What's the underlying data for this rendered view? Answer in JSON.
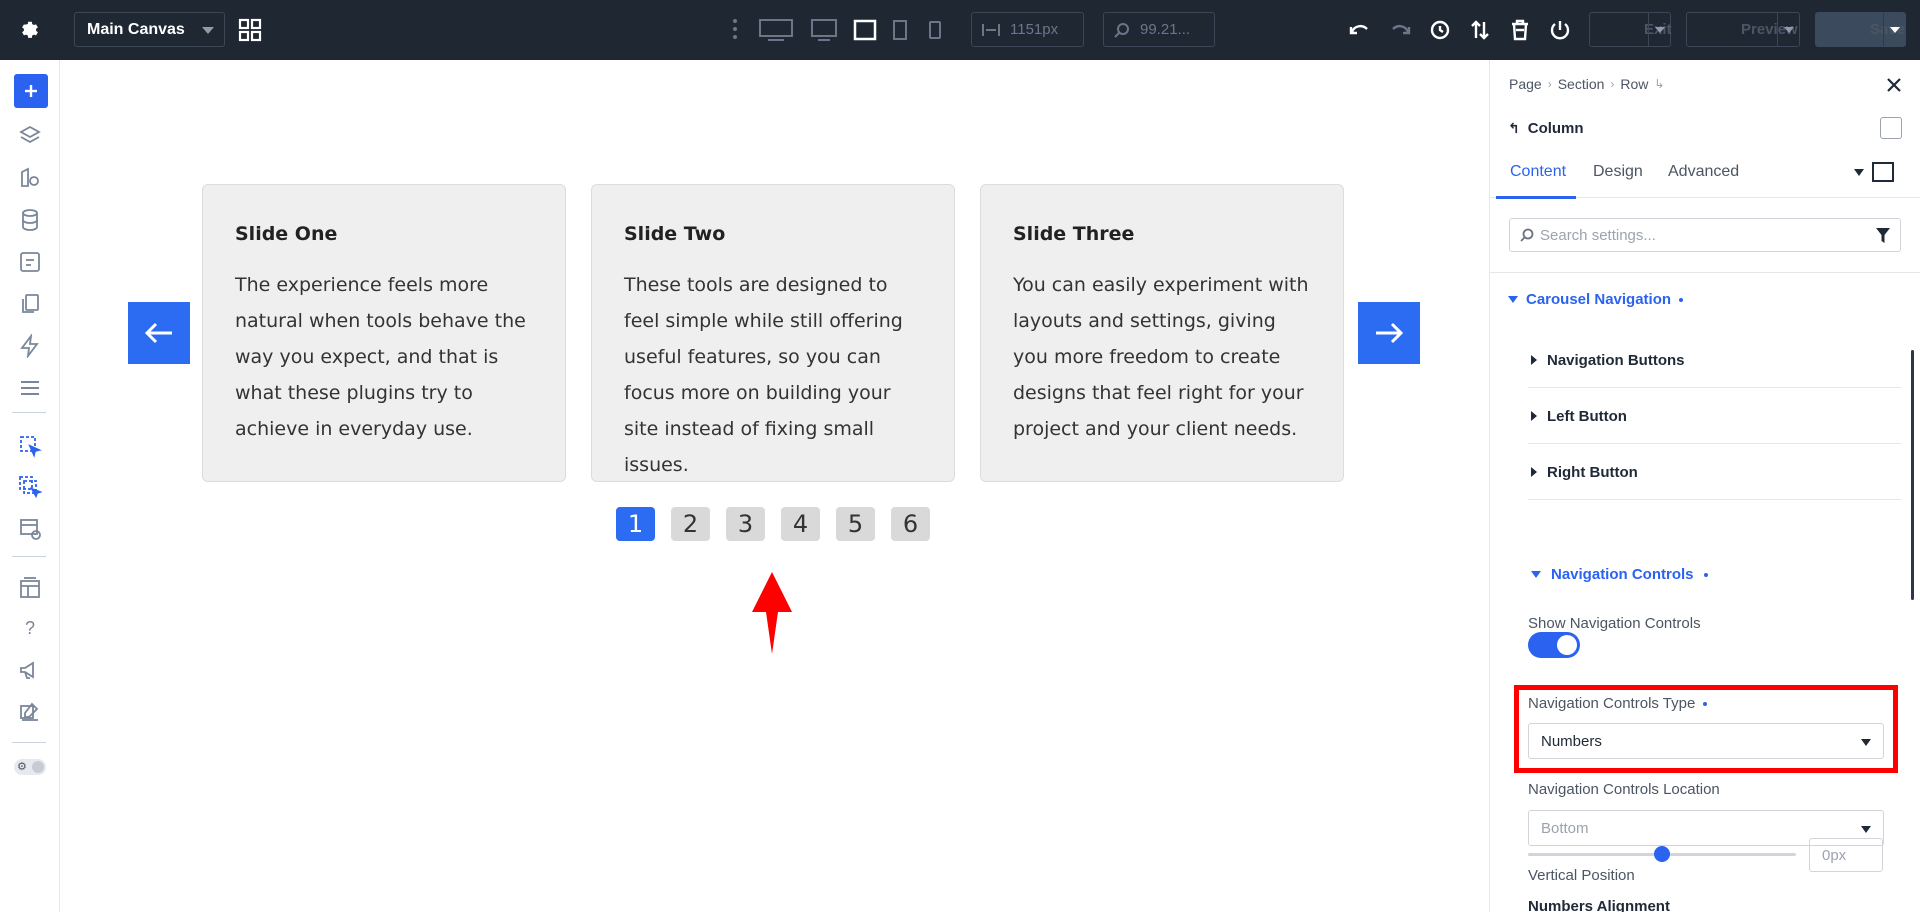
{
  "topbar": {
    "canvas_label": "Main Canvas",
    "width_value": "1151px",
    "zoom_value": "99.21...",
    "exit_label": "Exit",
    "preview_label": "Preview",
    "save_label": "Save"
  },
  "slides": [
    {
      "title": "Slide One",
      "body": "The experience feels more natural when tools behave the way you expect, and that is what these plugins try to achieve in everyday use."
    },
    {
      "title": "Slide Two",
      "body": "These tools are designed to feel simple while still offering useful features, so you can focus more on building your site instead of fixing small issues."
    },
    {
      "title": "Slide Three",
      "body": "You can easily experiment with layouts and settings, giving you more freedom to create designs that feel right for your project and your client needs."
    }
  ],
  "pager": {
    "pages": [
      "1",
      "2",
      "3",
      "4",
      "5",
      "6"
    ],
    "active": 0
  },
  "panel": {
    "breadcrumbs": [
      "Page",
      "Section",
      "Row"
    ],
    "title": "Column",
    "tabs": [
      "Content",
      "Design",
      "Advanced"
    ],
    "search_placeholder": "Search settings...",
    "group_label": "Carousel Navigation",
    "subgroups": [
      "Navigation Buttons",
      "Left Button",
      "Right Button"
    ],
    "open_subgroup": "Navigation Controls",
    "show_controls_label": "Show Navigation Controls",
    "show_controls_on": true,
    "controls_type_label": "Navigation Controls Type",
    "controls_type_value": "Numbers",
    "controls_location_label": "Navigation Controls Location",
    "controls_location_value": "Bottom",
    "vertical_position_label": "Vertical Position",
    "vertical_position_value": "0px",
    "numbers_alignment_label": "Numbers Alignment"
  },
  "colors": {
    "accent": "#2b63f0",
    "topbar": "#1f2733",
    "highlight": "#ff0000"
  }
}
